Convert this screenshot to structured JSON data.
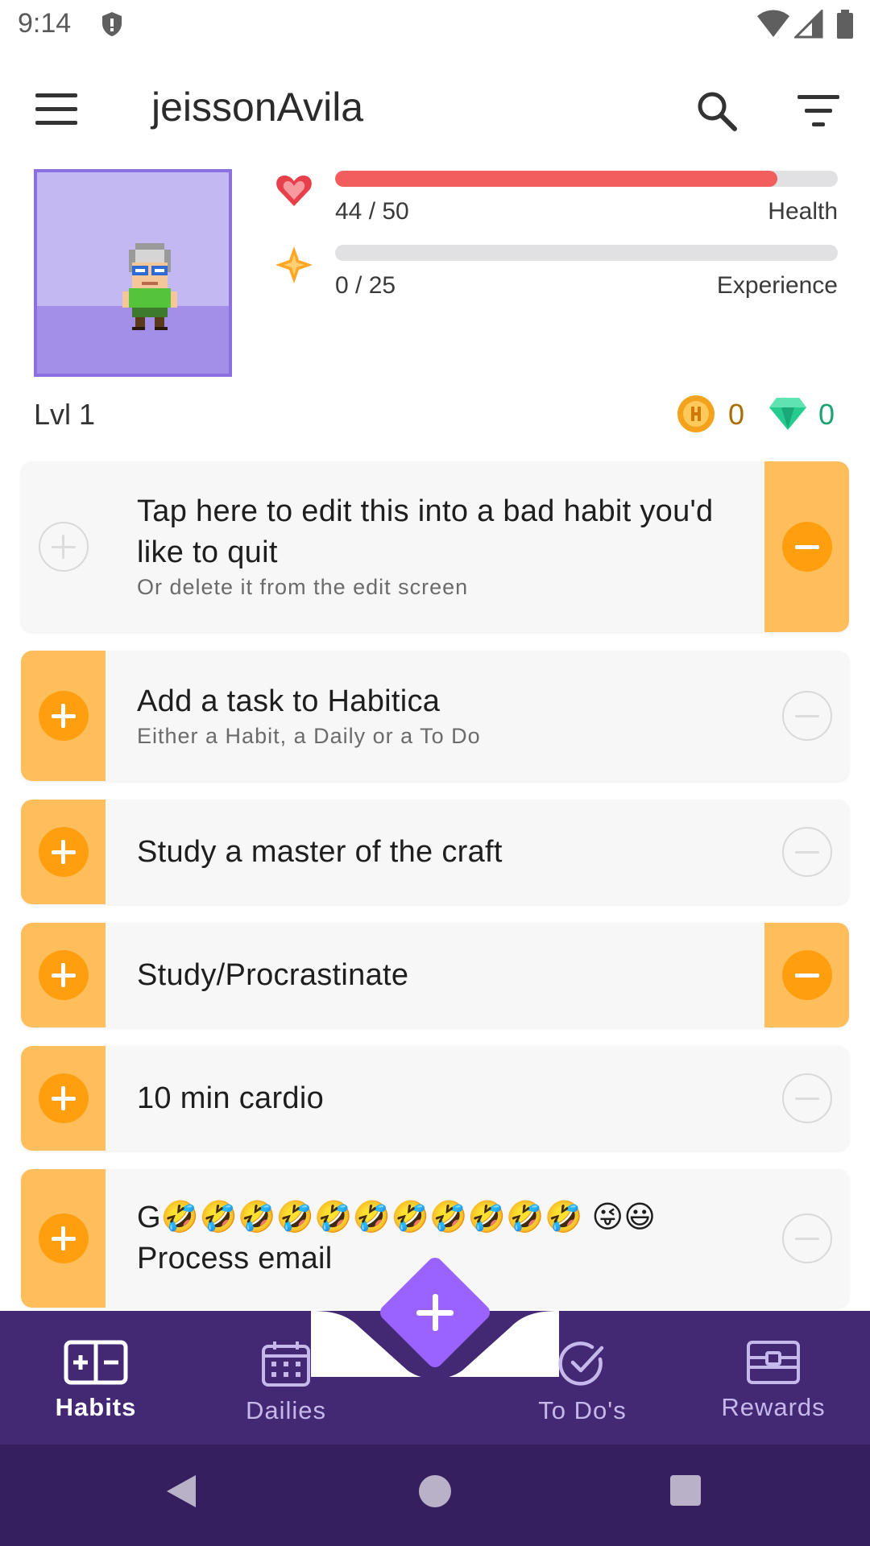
{
  "status_bar": {
    "time": "9:14",
    "icons": [
      "shield-icon",
      "wifi-icon",
      "signal-icon",
      "battery-icon"
    ]
  },
  "app_bar": {
    "title": "jeissonAvila",
    "icons": [
      "menu-icon",
      "search-icon",
      "filter-icon"
    ]
  },
  "header": {
    "health": {
      "value_text": "44 / 50",
      "label": "Health",
      "fraction": 0.88,
      "color": "#f25d5d"
    },
    "experience": {
      "value_text": "0 / 25",
      "label": "Experience",
      "fraction": 0.0,
      "color": "#ffa624"
    },
    "level": "Lvl 1",
    "gold": "0",
    "gems": "0"
  },
  "habits": [
    {
      "title": "Tap here to edit this into a bad habit you'd like to quit",
      "notes": "Or delete it from the edit screen",
      "up_active": false,
      "down_active": true
    },
    {
      "title": "Add a task to Habitica",
      "notes": "Either a Habit, a Daily or a To Do",
      "up_active": true,
      "down_active": false
    },
    {
      "title": "Study a master of the craft",
      "notes": "",
      "up_active": true,
      "down_active": false
    },
    {
      "title": "Study/Procrastinate",
      "notes": "",
      "up_active": true,
      "down_active": true
    },
    {
      "title": "10 min cardio",
      "notes": "",
      "up_active": true,
      "down_active": false
    },
    {
      "title": "G🤣🤣🤣🤣🤣🤣🤣🤣🤣🤣🤣 😜😃",
      "title_line2": "Process email",
      "notes": "",
      "up_active": true,
      "down_active": false
    }
  ],
  "bottom_nav": {
    "items": [
      {
        "label": "Habits",
        "icon": "habits-icon",
        "selected": true
      },
      {
        "label": "Dailies",
        "icon": "calendar-icon",
        "selected": false
      },
      {
        "label": "To Do's",
        "icon": "check-circle-icon",
        "selected": false
      },
      {
        "label": "Rewards",
        "icon": "chest-icon",
        "selected": false
      }
    ],
    "fab_icon": "add-icon"
  },
  "colors": {
    "nav_background": "#432874",
    "system_nav_background": "#361f5e",
    "habit_button_active": "#ffbe5c",
    "habit_button_circle": "#ff9f10",
    "fab": "#9a62ff",
    "avatar_background": "#c4b8f2"
  }
}
